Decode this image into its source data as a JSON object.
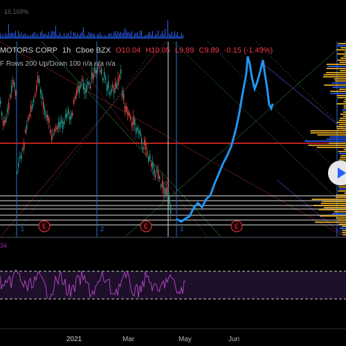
{
  "app": {
    "volume_percent": "16.169%"
  },
  "header": {
    "symbol": "MOTORS CORP",
    "interval": "1h",
    "exchange": "Cboe BZX",
    "open": "O10.04",
    "high": "H10.05",
    "low": "L9.89",
    "close": "C9.89",
    "change": "-0.15 (-1.49%)"
  },
  "indicator": {
    "label": "F Rows 200 Up/Down 100",
    "values": [
      "n/a",
      "n/a",
      "n/a"
    ]
  },
  "rsi": {
    "value": "34"
  },
  "markers": {
    "session_labels": [
      "1",
      "2",
      "3",
      "5"
    ],
    "earnings_label": "E"
  },
  "x_axis": [
    "2021",
    "Mar",
    "May",
    "Jun"
  ],
  "colors": {
    "background": "#000000",
    "price_line": "#2196f3",
    "candles_up": "#26a69a",
    "candles_down": "#ef5350",
    "rsi": "#9c27b0",
    "volume_profile": "#f0b429",
    "hline": "#ff3333",
    "accent": "#2962ff"
  },
  "icons": {
    "play": "play-icon"
  }
}
